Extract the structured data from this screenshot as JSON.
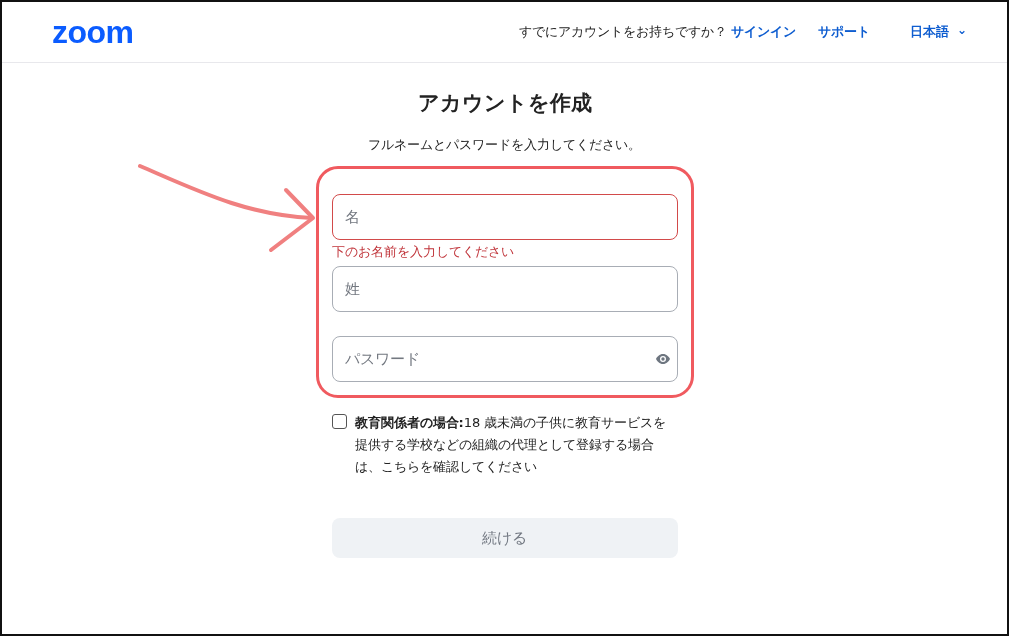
{
  "header": {
    "logo": "zoom",
    "prompt": "すでにアカウントをお持ちですか？",
    "links": [
      {
        "label": "サインイン"
      },
      {
        "label": "サポート"
      }
    ],
    "language": {
      "label": "日本語",
      "caret": "⌄"
    }
  },
  "form": {
    "title": "アカウントを作成",
    "subtitle": "フルネームとパスワードを入力してください。",
    "fields": [
      {
        "kind": "text",
        "placeholder": "名",
        "error": true,
        "error_text": "下のお名前を入力してください"
      },
      {
        "kind": "text",
        "placeholder": "姓",
        "error": false
      },
      {
        "kind": "password",
        "placeholder": "パスワード",
        "error": false
      }
    ],
    "educator": {
      "checked": false,
      "text": "**教育関係者の場合:**18 歳未満の子供に教育サービスを提供する学校などの組織の代理として登録する場合は、こちらを確認してください"
    },
    "submit": {
      "label": "続ける",
      "disabled": true
    }
  }
}
